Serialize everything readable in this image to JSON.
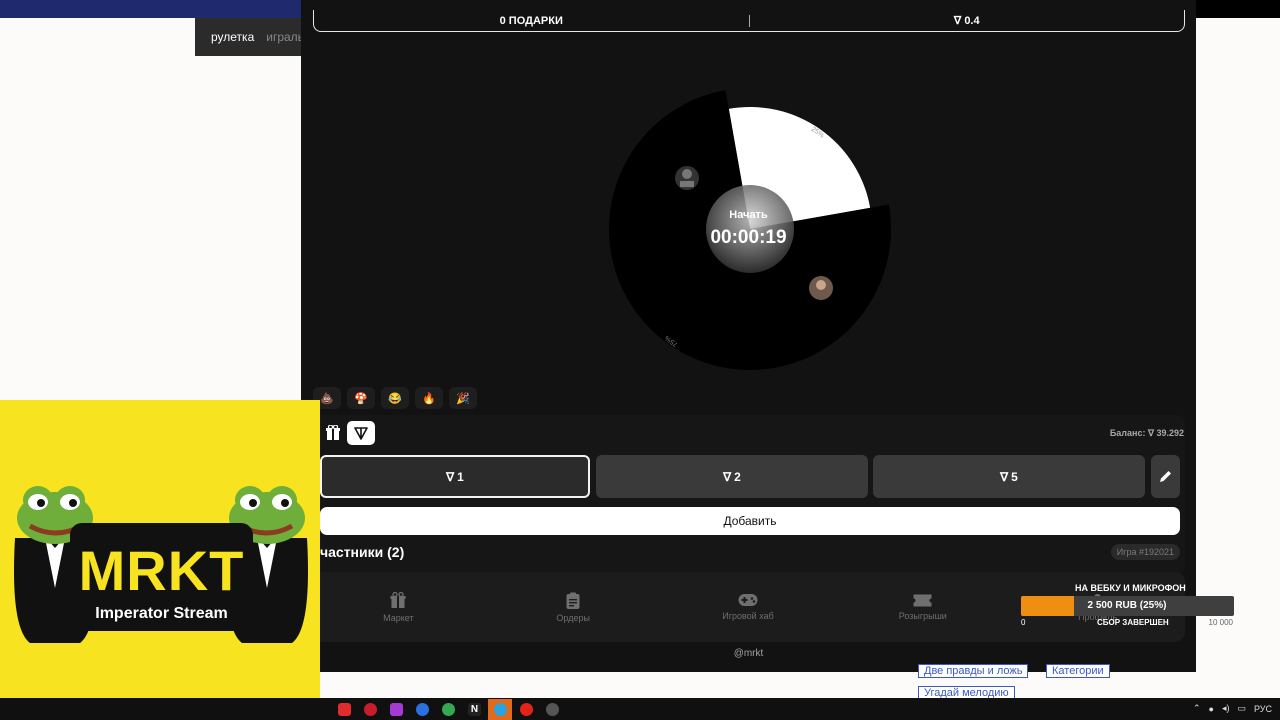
{
  "browser": {
    "tabs": [
      "рулетка",
      "игральн"
    ]
  },
  "game": {
    "tabs": {
      "gifts": "0 ПОДАРКИ",
      "ton": "0.4"
    },
    "wheel": {
      "segments": [
        {
          "percent": 25,
          "label": "25%",
          "color": "#ffffff"
        },
        {
          "percent": 75,
          "label": "75%",
          "color": "#000000"
        }
      ]
    },
    "timer": {
      "title": "Начать",
      "value": "00:00:19"
    },
    "reactions": [
      "💩",
      "🍄",
      "😂",
      "🔥",
      "🎉"
    ],
    "balance": "Баланс: ∇ 39.292",
    "amounts": [
      "1",
      "2",
      "5"
    ],
    "add_label": "Добавить",
    "participants_label": "частники (2)",
    "game_id": "Игра #192021",
    "nav": [
      {
        "label": "Маркет",
        "icon": "gift-icon"
      },
      {
        "label": "Ордеры",
        "icon": "clipboard-icon"
      },
      {
        "label": "Игровой хаб",
        "icon": "gamepad-icon"
      },
      {
        "label": "Розыгрыши",
        "icon": "ticket-icon"
      },
      {
        "label": "Профиль",
        "icon": "profile-icon"
      }
    ],
    "footer": "@mrkt"
  },
  "stream": {
    "logo_title": "MRKT",
    "logo_subtitle": "Imperator Stream",
    "donation": {
      "title": "НА ВЕБКУ И МИКРОФОН",
      "amount": "2 500 RUB (25%)",
      "progress": 0.25,
      "min": "0",
      "status": "СБОР ЗАВЕРШЕН",
      "max": "10 000"
    }
  },
  "background_links": [
    "Две правды и ложь",
    "Категории",
    "Угадай мелодию"
  ],
  "taskbar": {
    "language": "РУС"
  },
  "colors": {
    "app_bg": "#121212",
    "button_bg": "#3a3a3a",
    "logo_bg": "#f7e31f",
    "donation_fill": "#ee8f12"
  }
}
